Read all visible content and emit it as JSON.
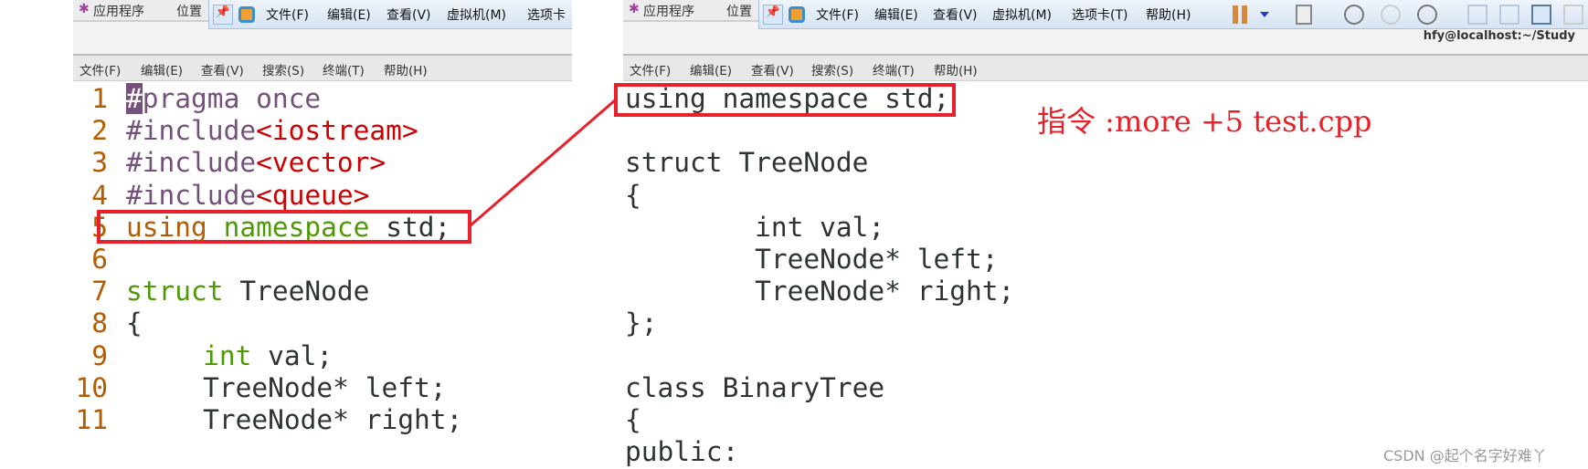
{
  "left": {
    "topbar": {
      "apps": "应用程序",
      "places": "位置"
    },
    "vm_menu": [
      "文件(F)",
      "编辑(E)",
      "查看(V)",
      "虚拟机(M)",
      "选项卡"
    ],
    "menu": [
      "文件(F)",
      "编辑(E)",
      "查看(V)",
      "搜索(S)",
      "终端(T)",
      "帮助(H)"
    ],
    "lines": [
      {
        "n": "1",
        "parts": [
          [
            "pp cursor",
            "#"
          ],
          [
            "pp",
            "pragma once"
          ]
        ]
      },
      {
        "n": "2",
        "parts": [
          [
            "pp",
            "#include"
          ],
          [
            "str",
            "<iostream>"
          ]
        ]
      },
      {
        "n": "3",
        "parts": [
          [
            "pp",
            "#include"
          ],
          [
            "str",
            "<vector>"
          ]
        ]
      },
      {
        "n": "4",
        "parts": [
          [
            "pp",
            "#include"
          ],
          [
            "str",
            "<queue>"
          ]
        ]
      },
      {
        "n": "5",
        "parts": [
          [
            "ty",
            "using"
          ],
          [
            "",
            " "
          ],
          [
            "kw",
            "namespace"
          ],
          [
            "",
            " std;"
          ]
        ]
      },
      {
        "n": "6",
        "parts": []
      },
      {
        "n": "7",
        "parts": [
          [
            "kw",
            "struct"
          ],
          [
            "",
            " TreeNode"
          ]
        ]
      },
      {
        "n": "8",
        "parts": [
          [
            "",
            "{"
          ]
        ]
      },
      {
        "n": "9",
        "parts": [
          [
            "",
            "\t"
          ],
          [
            "kw",
            "int"
          ],
          [
            "",
            " val;"
          ]
        ]
      },
      {
        "n": "10",
        "parts": [
          [
            "",
            "\tTreeNode* left;"
          ]
        ]
      },
      {
        "n": "11",
        "parts": [
          [
            "",
            "\tTreeNode* right;"
          ]
        ]
      }
    ]
  },
  "right": {
    "topbar": {
      "apps": "应用程序",
      "places": "位置"
    },
    "vm_menu": [
      "文件(F)",
      "编辑(E)",
      "查看(V)",
      "虚拟机(M)",
      "选项卡(T)",
      "帮助(H)"
    ],
    "window_title": "hfy@localhost:~/Study",
    "menu": [
      "文件(F)",
      "编辑(E)",
      "查看(V)",
      "搜索(S)",
      "终端(T)",
      "帮助(H)"
    ],
    "lines": [
      "using namespace std;",
      "",
      "struct TreeNode",
      "{",
      "\tint val;",
      "\tTreeNode* left;",
      "\tTreeNode* right;",
      "};",
      "",
      "class BinaryTree",
      "{",
      "public:"
    ]
  },
  "annotation": "指令 :more +5 test.cpp",
  "watermark": "CSDN @起个名字好难丫",
  "colors": {
    "highlight": "#e8202a",
    "line_number": "#b35c00",
    "preprocessor": "#75507b",
    "string": "#cc0000",
    "keyword": "#4e9a06"
  }
}
